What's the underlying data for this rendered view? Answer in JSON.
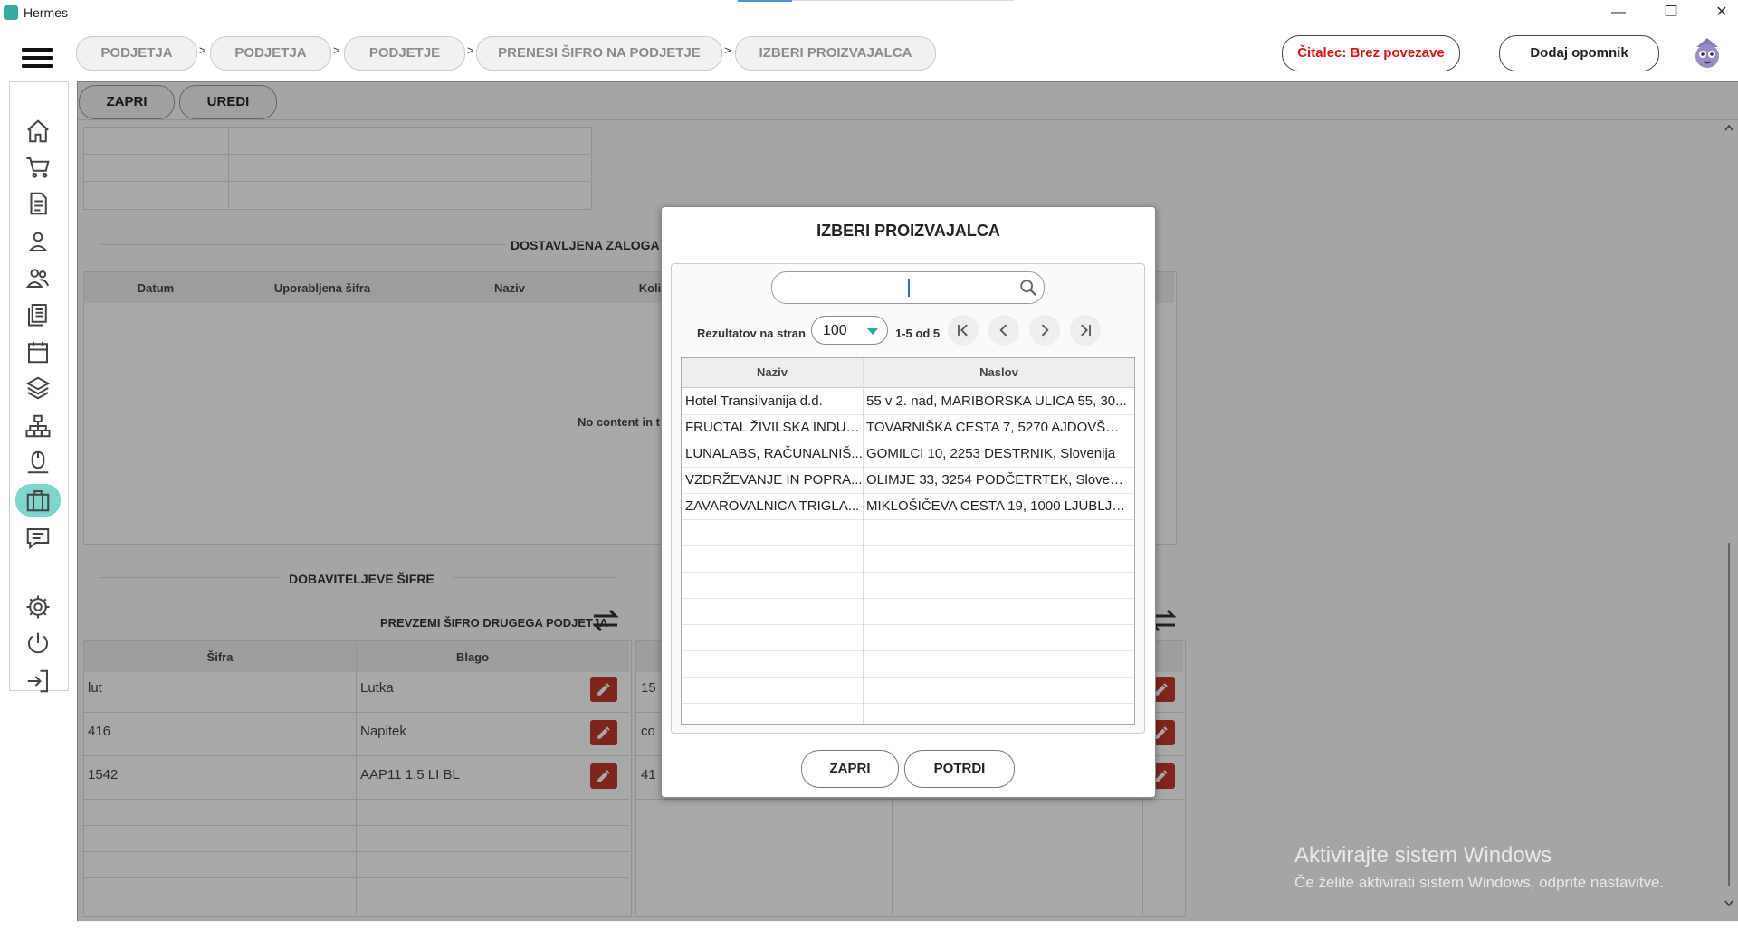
{
  "window": {
    "title": "Hermes",
    "minimize": "—",
    "restore": "❐",
    "close": "✕"
  },
  "breadcrumbs": [
    "PODJETJA",
    "PODJETJA",
    "PODJETJE",
    "PRENESI ŠIFRO NA PODJETJE",
    "IZBERI PROIZVAJALCA"
  ],
  "breadcrumb_separator": ">",
  "header": {
    "reader_label": "Čitalec: Brez povezave",
    "reminder_label": "Dodaj opomnik"
  },
  "sidebar": {
    "icons": [
      "home-icon",
      "cart-icon",
      "document-icon",
      "user-icon",
      "users-icon",
      "list-icon",
      "calendar-icon",
      "layers-icon",
      "hierarchy-icon",
      "mouse-icon",
      "briefcase-icon",
      "chat-icon",
      "gear-icon",
      "power-icon",
      "logout-icon"
    ],
    "active": "briefcase-icon"
  },
  "toolbar": {
    "close_label": "ZAPRI",
    "edit_label": "UREDI"
  },
  "delivered": {
    "title": "DOSTAVLJENA ZALOGA P",
    "columns": [
      "Datum",
      "Uporabljena šifra",
      "Naziv",
      "Koli"
    ],
    "empty_text": "No content in t"
  },
  "supplier_codes": {
    "title": "DOBAVITELJEVE ŠIFRE",
    "transfer_label": "PREVZEMI ŠIFRO DRUGEGA PODJETJA",
    "columns": [
      "Šifra",
      "Blago"
    ],
    "rows": [
      {
        "code": "lut",
        "item": "Lutka"
      },
      {
        "code": "416",
        "item": "Napitek"
      },
      {
        "code": "1542",
        "item": "AAP11 1.5 LI BL"
      }
    ],
    "right_codes": [
      "15",
      "co",
      "41"
    ]
  },
  "watermark": {
    "line1": "Aktivirajte sistem Windows",
    "line2": "Če želite aktivirati sistem Windows, odprite nastavitve."
  },
  "modal": {
    "title": "IZBERI PROIZVAJALCA",
    "search_value": "",
    "results_per_page_label": "Rezultatov na stran",
    "results_per_page": "100",
    "range_text": "1-5 od 5",
    "columns": [
      "Naziv",
      "Naslov"
    ],
    "rows": [
      {
        "name": "Hotel Transilvanija d.d.",
        "address": "55 v 2. nad, MARIBORSKA ULICA 55, 30..."
      },
      {
        "name": "FRUCTAL ŽIVILSKA INDUS...",
        "address": "TOVARNIŠKA CESTA 7, 5270 AJDOVŠČIN..."
      },
      {
        "name": "LUNALABS, RAČUNALNIŠ...",
        "address": "GOMILCI 10, 2253 DESTRNIK, Slovenija"
      },
      {
        "name": "VZDRŽEVANJE IN POPRA...",
        "address": "OLIMJE 33, 3254 PODČETRTEK, Slovenija"
      },
      {
        "name": "ZAVAROVALNICA TRIGLA...",
        "address": "MIKLOŠIČEVA CESTA 19, 1000 LJUBLJAN..."
      }
    ],
    "close_label": "ZAPRI",
    "confirm_label": "POTRDI"
  }
}
